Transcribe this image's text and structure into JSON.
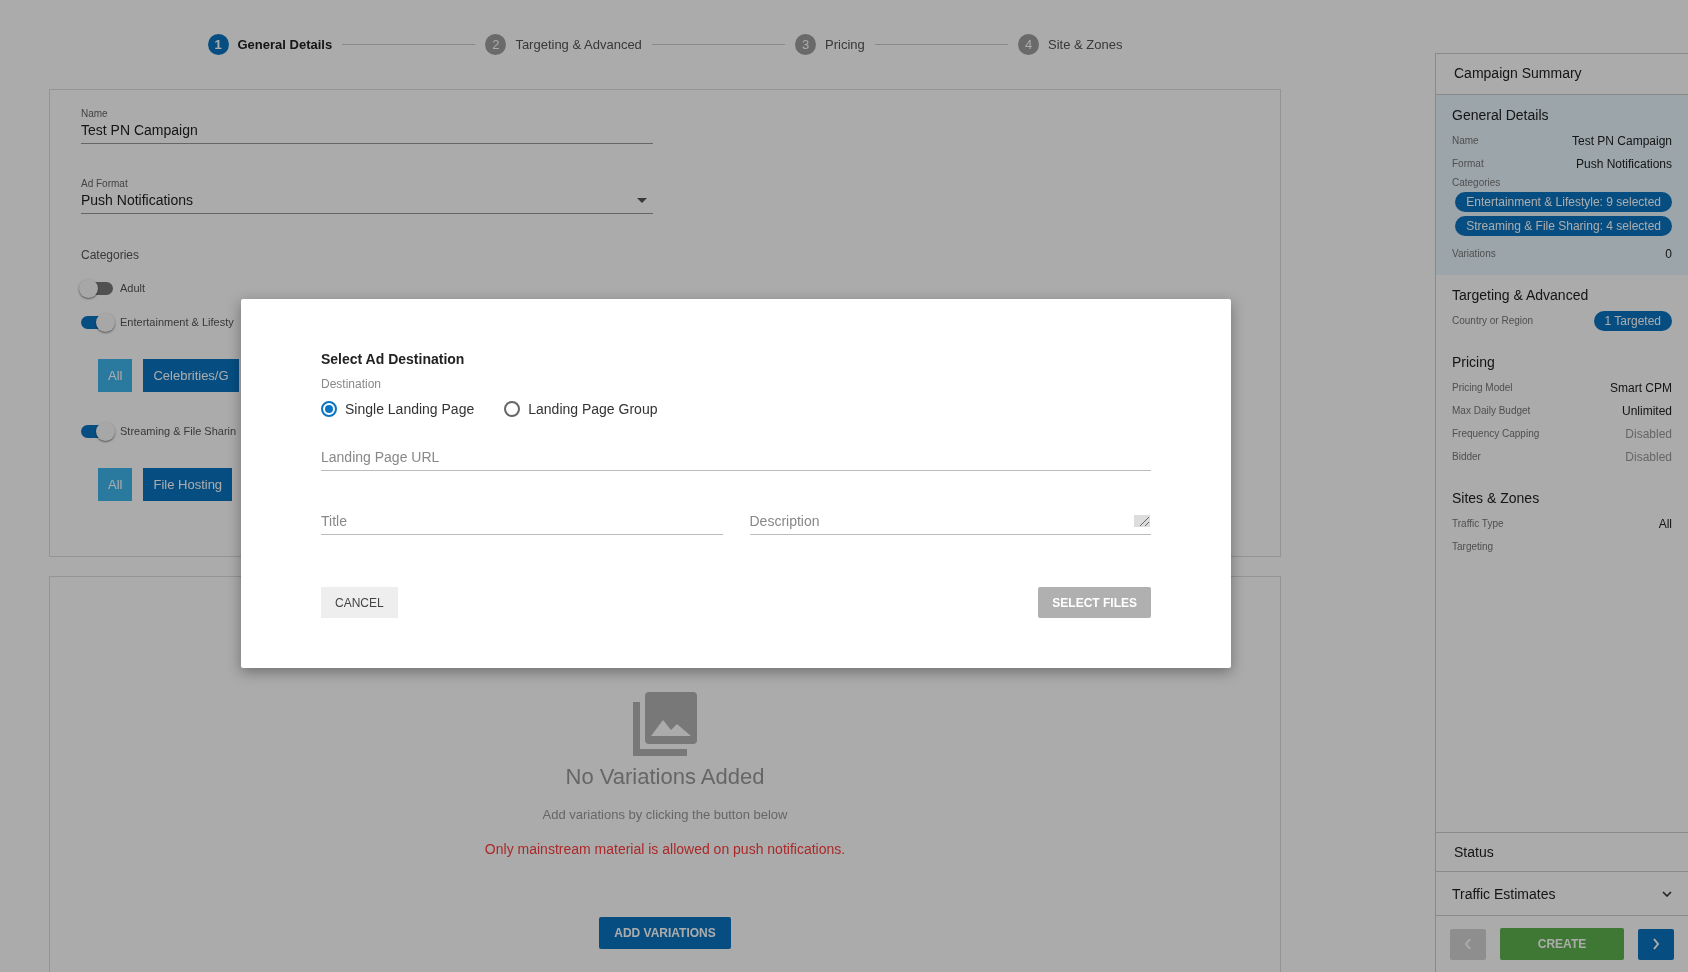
{
  "steps": [
    {
      "number": "1",
      "label": "General Details",
      "selected": true
    },
    {
      "number": "2",
      "label": "Targeting & Advanced",
      "selected": false
    },
    {
      "number": "3",
      "label": "Pricing",
      "selected": false
    },
    {
      "number": "4",
      "label": "Site & Zones",
      "selected": false
    }
  ],
  "form": {
    "name": {
      "label": "Name",
      "value": "Test PN Campaign"
    },
    "ad_format": {
      "label": "Ad Format",
      "value": "Push Notifications"
    },
    "categories_label": "Categories",
    "categories": [
      {
        "label": "Adult",
        "on": false
      },
      {
        "label": "Entertainment & Lifesty",
        "on": true,
        "chips": [
          {
            "label": "All",
            "kind": "all"
          },
          {
            "label": "Celebrities/G",
            "kind": "sub"
          }
        ]
      },
      {
        "label": "Streaming & File Sharin",
        "on": true,
        "chips": [
          {
            "label": "All",
            "kind": "all"
          },
          {
            "label": "File Hosting",
            "kind": "sub"
          }
        ]
      }
    ]
  },
  "variations": {
    "title": "No Variations Added",
    "hint": "Add variations by clicking the button below",
    "warning": "Only mainstream material is allowed on push notifications.",
    "button": "ADD VARIATIONS"
  },
  "modal": {
    "title": "Select Ad Destination",
    "destination_label": "Destination",
    "options": [
      {
        "label": "Single Landing Page",
        "selected": true
      },
      {
        "label": "Landing Page Group",
        "selected": false
      }
    ],
    "url": {
      "placeholder": "Landing Page URL"
    },
    "title_field": {
      "placeholder": "Title"
    },
    "description": {
      "placeholder": "Description"
    },
    "cancel": "CANCEL",
    "select_files": {
      "label": "SELECT FILES",
      "disabled": true
    }
  },
  "summary": {
    "title": "Campaign Summary",
    "sections": [
      {
        "title": "General Details",
        "highlighted": true,
        "rows": [
          {
            "label": "Name",
            "kind": "text",
            "values": [
              "Test PN Campaign"
            ]
          },
          {
            "label": "Format",
            "kind": "text",
            "values": [
              "Push Notifications"
            ]
          },
          {
            "label": "Categories",
            "kind": "pills",
            "values": [
              "Entertainment & Lifestyle: 9 selected",
              "Streaming & File Sharing: 4 selected"
            ]
          },
          {
            "label": "Variations",
            "kind": "text",
            "values": [
              "0"
            ]
          }
        ]
      },
      {
        "title": "Targeting & Advanced",
        "highlighted": false,
        "rows": [
          {
            "label": "Country or Region",
            "kind": "pill",
            "values": [
              "1 Targeted"
            ]
          }
        ]
      },
      {
        "title": "Pricing",
        "highlighted": false,
        "rows": [
          {
            "label": "Pricing Model",
            "kind": "text",
            "values": [
              "Smart CPM"
            ]
          },
          {
            "label": "Max Daily Budget",
            "kind": "text",
            "values": [
              "Unlimited"
            ]
          },
          {
            "label": "Frequency Capping",
            "kind": "muted",
            "values": [
              "Disabled"
            ]
          },
          {
            "label": "Bidder",
            "kind": "muted",
            "values": [
              "Disabled"
            ]
          }
        ]
      },
      {
        "title": "Sites & Zones",
        "highlighted": false,
        "rows": [
          {
            "label": "Traffic Type",
            "kind": "text",
            "values": [
              "All"
            ]
          },
          {
            "label": "Targeting",
            "kind": "text",
            "values": []
          }
        ]
      }
    ],
    "status": "Status",
    "traffic_estimates": {
      "label": "Traffic Estimates",
      "expanded": false
    },
    "back": {
      "disabled": true
    },
    "create": "CREATE",
    "next": {
      "disabled": false
    }
  }
}
